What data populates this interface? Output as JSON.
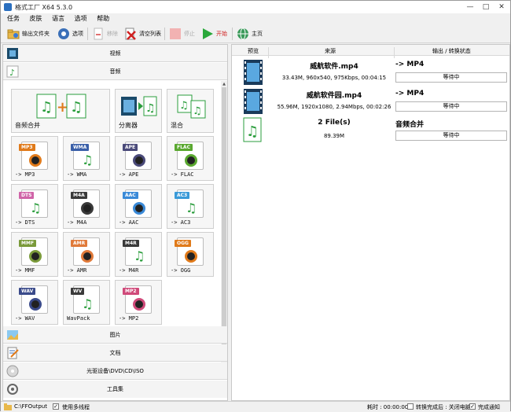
{
  "window": {
    "title": "格式工厂 X64 5.3.0"
  },
  "menu": [
    "任务",
    "皮肤",
    "语言",
    "选项",
    "帮助"
  ],
  "toolbar": {
    "output_folder": "输出文件夹",
    "options": "选项",
    "remove": "移除",
    "clear_list": "清空列表",
    "stop": "停止",
    "start": "开始",
    "home": "主页"
  },
  "categories": {
    "video": "视频",
    "audio": "音频",
    "image": "图片",
    "document": "文档",
    "disc": "光驱设备\\DVD\\CD\\ISO",
    "tools": "工具集"
  },
  "audio_tiles": [
    {
      "label": "音频合并",
      "icon": "audio-merge-icon"
    },
    {
      "label": "分离器",
      "icon": "splitter-icon"
    },
    {
      "label": "混合",
      "icon": "mix-icon"
    },
    {
      "label": "-> MP3",
      "tag": "MP3",
      "color": "#e07a1a"
    },
    {
      "label": "-> WMA",
      "tag": "WMA",
      "color": "#3a5fa8"
    },
    {
      "label": "-> APE",
      "tag": "APE",
      "color": "#4a4a7a"
    },
    {
      "label": "-> FLAC",
      "tag": "FLAC",
      "color": "#5aa830"
    },
    {
      "label": "-> DTS",
      "tag": "DTS",
      "color": "#d064a8"
    },
    {
      "label": "-> M4A",
      "tag": "M4A",
      "color": "#3a3a3a"
    },
    {
      "label": "-> AAC",
      "tag": "AAC",
      "color": "#3a8ad8"
    },
    {
      "label": "-> AC3",
      "tag": "AC3",
      "color": "#3a9ad8"
    },
    {
      "label": "-> MMF",
      "tag": "MMF",
      "color": "#7a9a3a"
    },
    {
      "label": "-> AMR",
      "tag": "AMR",
      "color": "#e07a3a"
    },
    {
      "label": "-> M4R",
      "tag": "M4R",
      "color": "#3a3a3a"
    },
    {
      "label": "-> OGG",
      "tag": "OGG",
      "color": "#e07a1a"
    },
    {
      "label": "-> WAV",
      "tag": "WAV",
      "color": "#3a4a8a"
    },
    {
      "label": "WavPack",
      "tag": "WV",
      "color": "#3a3a3a"
    },
    {
      "label": "-> MP2",
      "tag": "MP2",
      "color": "#d04a7a"
    }
  ],
  "task_table": {
    "headers": {
      "preview": "预览",
      "source": "来源",
      "output_status": "输出 / 转换状态"
    },
    "jobs": [
      {
        "name": "威航软件.mp4",
        "meta": "33.43M, 960x540, 975Kbps, 00:04:15",
        "target": "-> MP4",
        "status": "等待中"
      },
      {
        "name": "威航软件园.mp4",
        "meta": "55.96M, 1920x1080, 2.94Mbps, 00:02:26",
        "target": "-> MP4",
        "status": "等待中"
      },
      {
        "name": "2 File(s)",
        "meta": "89.39M",
        "target": "音频合并",
        "status": "等待中"
      }
    ]
  },
  "statusbar": {
    "output_path": "C:\\FFOutput",
    "multithread": "使用多线程",
    "elapsed": "耗时 : 00:00:00",
    "after_convert": "转换完成后 : 关闭电脑",
    "notify": "完成通知"
  }
}
